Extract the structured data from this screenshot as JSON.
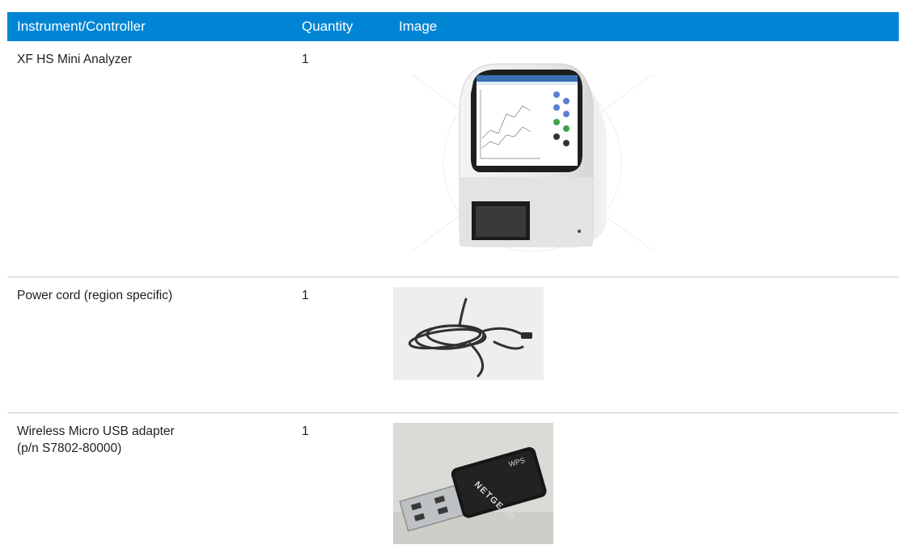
{
  "table": {
    "headers": [
      "Instrument/Controller",
      "Quantity",
      "Image"
    ],
    "rows": [
      {
        "name": "XF HS Mini Analyzer",
        "quantity": "1",
        "image": "analyzer-photo"
      },
      {
        "name": "Power cord (region specific)",
        "quantity": "1",
        "image": "power-cord-photo"
      },
      {
        "name_line1": "Wireless Micro USB adapter",
        "name_line2": "(p/n S7802-80000)",
        "quantity": "1",
        "image": "usb-adapter-photo",
        "adapter_brand_text": "NETGEAR",
        "adapter_button_text": "WPS"
      }
    ]
  },
  "colors": {
    "header_bg": "#0085d5",
    "header_text": "#ffffff",
    "divider": "#c9c9c9"
  }
}
